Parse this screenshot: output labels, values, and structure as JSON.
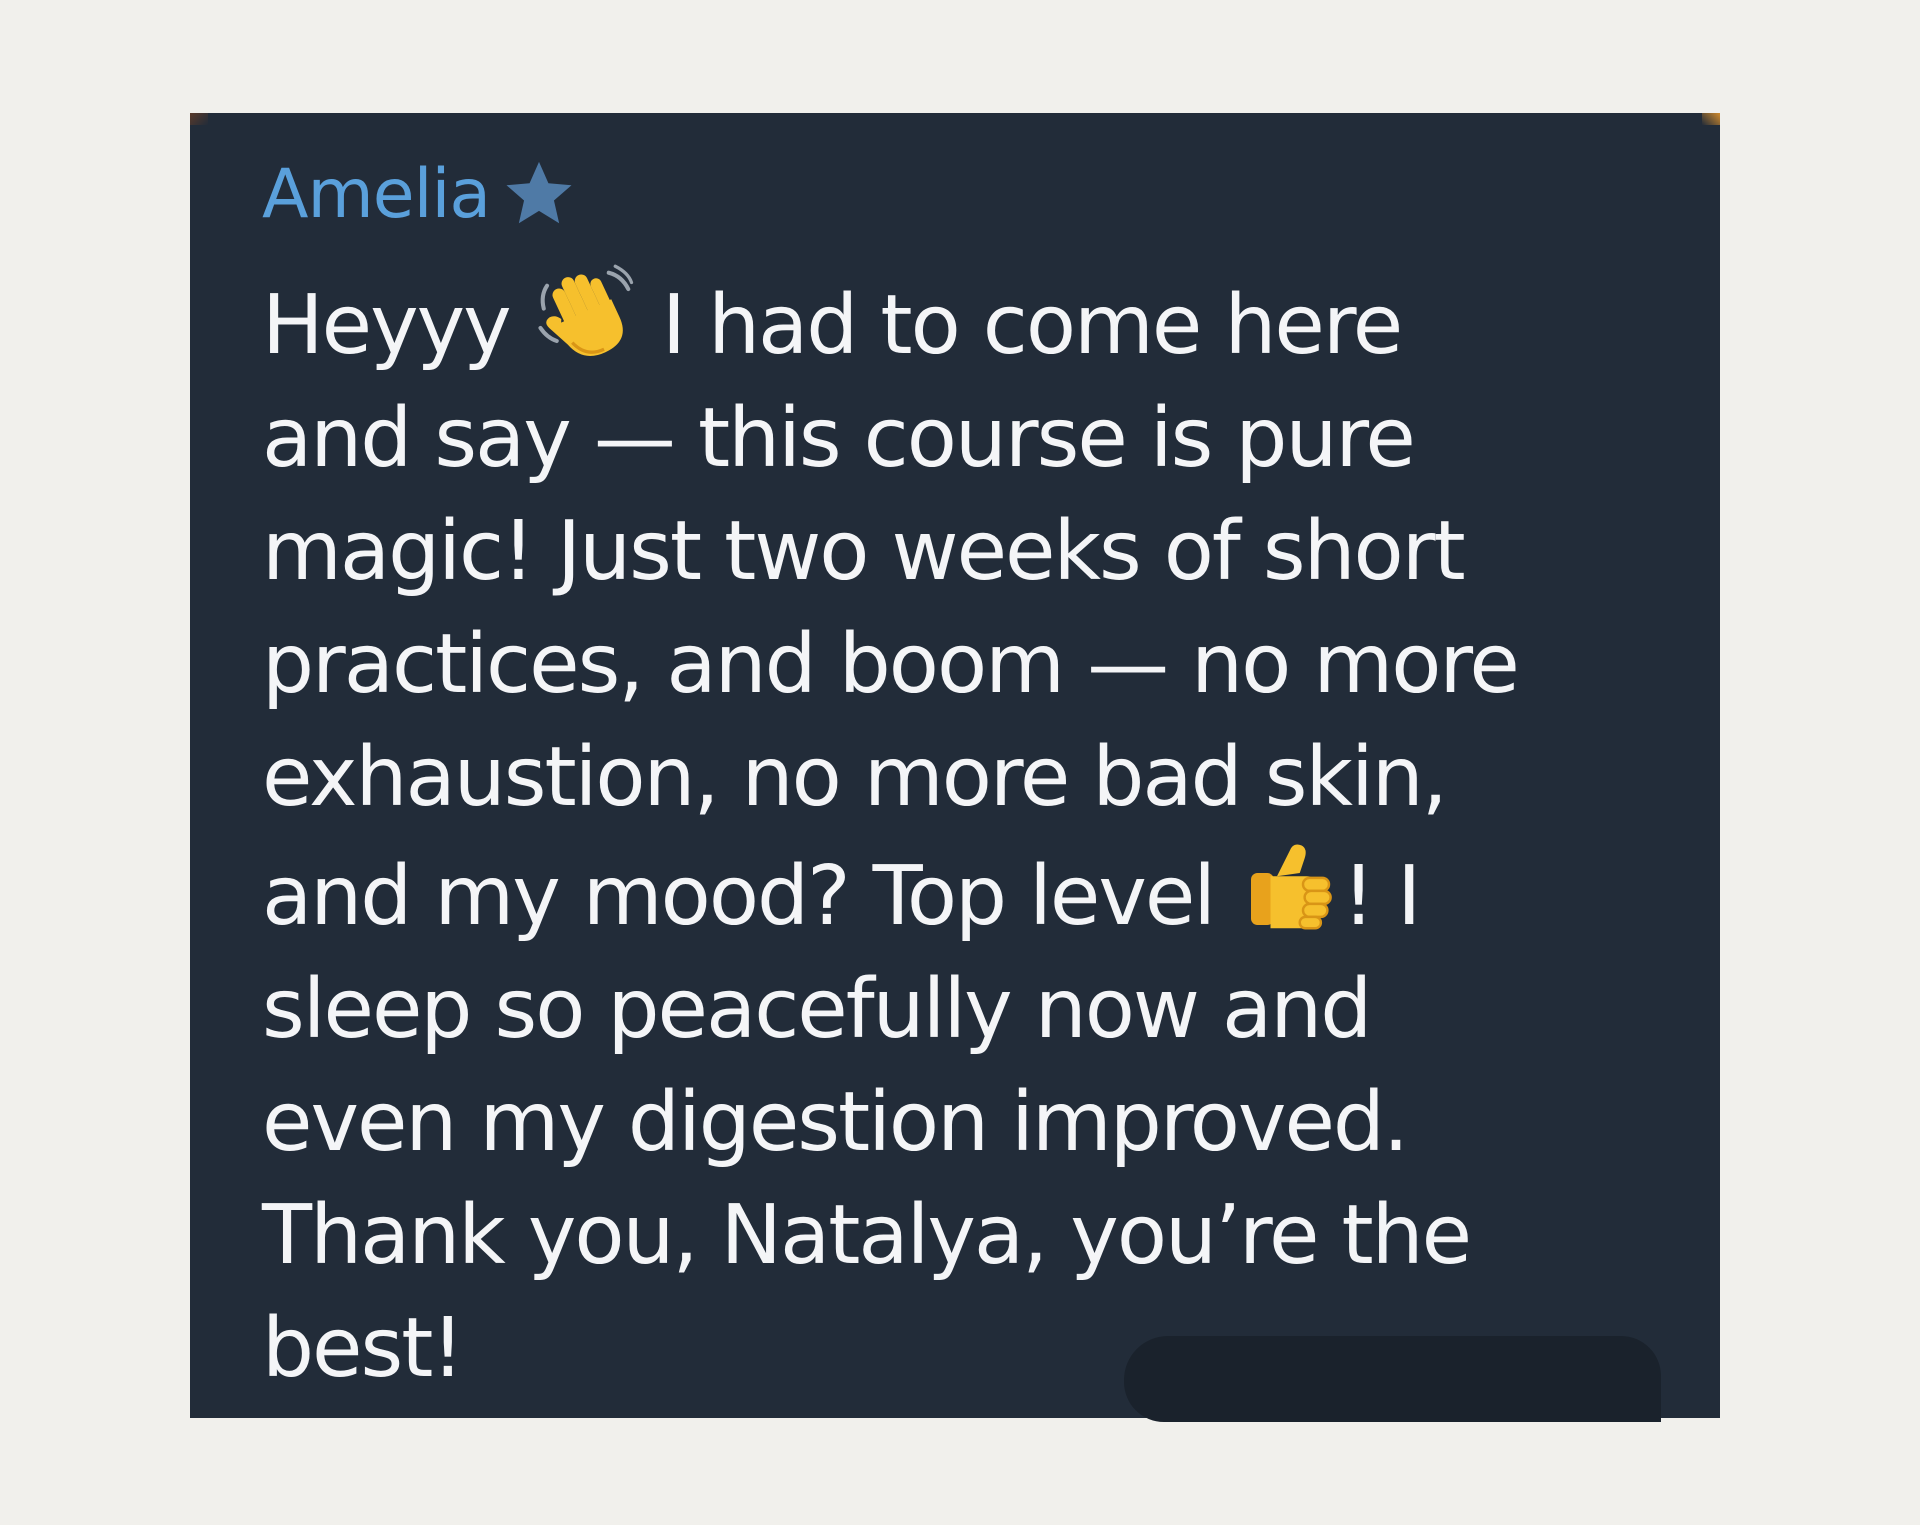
{
  "message": {
    "sender_name": "Amelia",
    "sender_badge_icon": "star-icon",
    "colors": {
      "bubble": "#222c39",
      "sender_name": "#5aa0db",
      "text": "#f4f5f7",
      "page": "#f1f0ec"
    },
    "lines": {
      "l1a": "Heyyy ",
      "l1b": " I had to come here",
      "l2": "and say — this course is pure",
      "l3": "magic! Just two weeks of short",
      "l4": "practices, and boom  — no more",
      "l5": "exhaustion, no more bad skin,",
      "l6a": "and my mood? Top level ",
      "l6b": "! I",
      "l7": "sleep so peacefully now and",
      "l8": "even my digestion improved.",
      "l9": "Thank you, Natalya, you’re the",
      "l10": "best!"
    },
    "emojis": [
      "waving-hand-icon",
      "thumbs-up-icon"
    ]
  }
}
